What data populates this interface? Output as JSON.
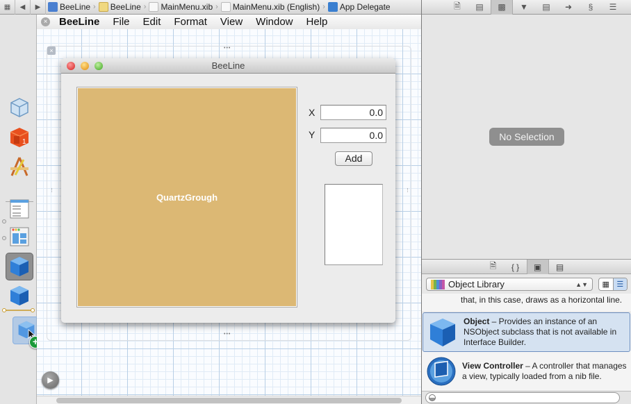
{
  "jumpbar": {
    "crumbs": [
      "BeeLine",
      "BeeLine",
      "MainMenu.xib",
      "MainMenu.xib (English)",
      "App Delegate"
    ]
  },
  "inspector_tabs": [
    "file-icon",
    "quick-help-icon",
    "identity-icon",
    "attributes-icon",
    "size-icon",
    "connections-icon",
    "bindings-icon",
    "effects-icon"
  ],
  "menubar": {
    "items": [
      "BeeLine",
      "File",
      "Edit",
      "Format",
      "View",
      "Window",
      "Help"
    ]
  },
  "window": {
    "title": "BeeLine",
    "custom_view_label": "QuartzGrough",
    "x_label": "X",
    "y_label": "Y",
    "x_value": "0.0",
    "y_value": "0.0",
    "add_button": "Add"
  },
  "inspector": {
    "no_selection": "No Selection"
  },
  "library": {
    "tabs": [
      "file-template-icon",
      "code-snippet-icon",
      "object-icon",
      "media-icon"
    ],
    "popup": "Object Library",
    "fragment": "that, in this case, draws as a horizontal line.",
    "items": [
      {
        "name": "Object",
        "desc": " – Provides an instance of an NSObject subclass that is not available in Interface Builder."
      },
      {
        "name": "View Controller",
        "desc": " – A controller that manages a view, typically loaded from a nib file."
      }
    ],
    "search_placeholder": ""
  },
  "colors": {
    "custom_view_fill": "#dcb874",
    "selection": "#d5e2f1"
  }
}
